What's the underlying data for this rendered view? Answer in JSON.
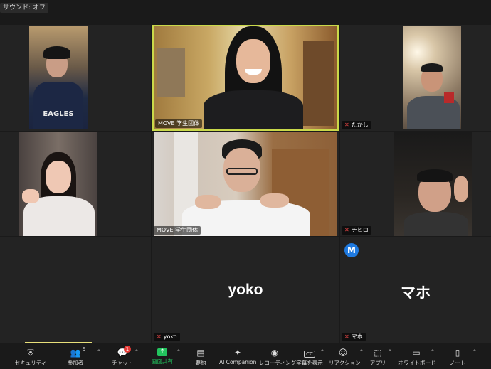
{
  "top": {
    "sound_label": "サウンド: オフ"
  },
  "tiles": {
    "t1": {
      "name": ""
    },
    "t2": {
      "name": "MOVE 学生団体"
    },
    "t3": {
      "name": "たかし"
    },
    "t4": {
      "name": ""
    },
    "t5": {
      "name": "MOVE 学生団体"
    },
    "t6": {
      "name": "チヒロ"
    },
    "t8": {
      "big_name": "yoko",
      "name": "yoko"
    },
    "t9": {
      "big_name": "マホ",
      "name": "マホ",
      "avatar_letter": "M"
    }
  },
  "colors": {
    "active_speaker": "#c9d94a",
    "mute": "#e64545",
    "share": "#22c55e",
    "avatar": "#1f7ae0"
  },
  "toolbar": {
    "security": {
      "label": "セキュリティ",
      "icon": "shield-icon"
    },
    "participants": {
      "label": "参加者",
      "count": "9",
      "icon": "people-icon"
    },
    "chat": {
      "label": "チャット",
      "badge": "1",
      "icon": "chat-icon"
    },
    "share": {
      "label": "画面共有",
      "icon": "share-screen-icon"
    },
    "summary": {
      "label": "要約",
      "icon": "summary-icon"
    },
    "ai": {
      "label": "AI Companion",
      "icon": "sparkle-icon"
    },
    "record": {
      "label": "レコーディング",
      "icon": "record-icon"
    },
    "captions": {
      "label": "字幕を表示",
      "icon": "cc-icon",
      "icon_text": "CC"
    },
    "reactions": {
      "label": "リアクション",
      "icon": "smile-icon"
    },
    "apps": {
      "label": "アプリ",
      "icon": "apps-icon"
    },
    "whiteboard": {
      "label": "ホワイトボード",
      "icon": "whiteboard-icon"
    },
    "notes": {
      "label": "ノート",
      "icon": "notes-icon"
    }
  }
}
